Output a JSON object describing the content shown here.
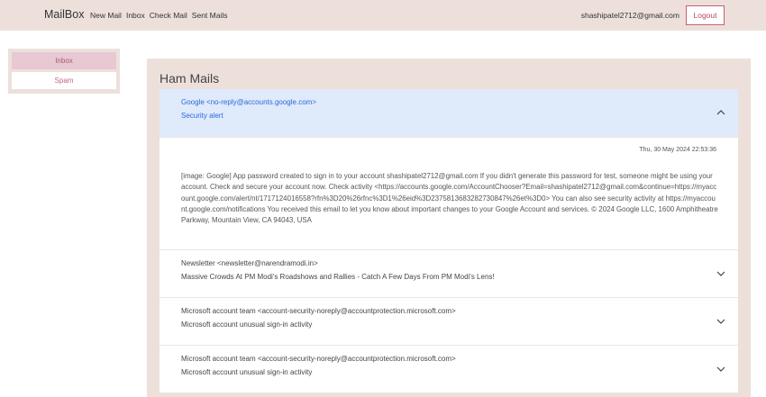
{
  "navbar": {
    "brand": "MailBox",
    "links": [
      "New Mail",
      "Inbox",
      "Check Mail",
      "Sent Mails"
    ],
    "user_email": "shashipatel2712@gmail.com",
    "logout_label": "Logout"
  },
  "sidebar": {
    "items": [
      {
        "label": "Inbox",
        "active": true
      },
      {
        "label": "Spam",
        "active": false
      }
    ]
  },
  "main": {
    "title": "Ham Mails",
    "mails": [
      {
        "from": "Google <no-reply@accounts.google.com>",
        "subject": "Security alert",
        "expanded": true,
        "date": "Thu, 30 May 2024 22:53:36",
        "body": "[image: Google] App password created to sign in to your account shashipatel2712@gmail.com If you didn't generate this password for test, someone might be using your account. Check and secure your account now. Check activity <https://accounts.google.com/AccountChooser?Email=shashipatel2712@gmail.com&continue=https://myaccount.google.com/alert/nt/1717124016558?rfn%3D20%26rfnc%3D1%26eid%3D2375813683282730847%26et%3D0> You can also see security activity at https://myaccount.google.com/notifications You received this email to let you know about important changes to your Google Account and services. © 2024 Google LLC, 1600 Amphitheatre Parkway, Mountain View, CA 94043, USA"
      },
      {
        "from": "Newsletter <newsletter@narendramodi.in>",
        "subject": "Massive Crowds At PM Modi's Roadshows and Rallies - Catch A Few Days From PM Modi's Lens!",
        "expanded": false
      },
      {
        "from": "Microsoft account team <account-security-noreply@accountprotection.microsoft.com>",
        "subject": "Microsoft account unusual sign-in activity",
        "expanded": false
      },
      {
        "from": "Microsoft account team <account-security-noreply@accountprotection.microsoft.com>",
        "subject": "Microsoft account unusual sign-in activity",
        "expanded": false
      }
    ]
  },
  "colors": {
    "nav_bg": "#ede0db",
    "accent": "#c9606f",
    "expanded_bg": "#dfeafb",
    "expanded_text": "#2b6ad8"
  },
  "icons": {
    "expand": "chevron-down-icon",
    "collapse": "chevron-up-icon"
  }
}
